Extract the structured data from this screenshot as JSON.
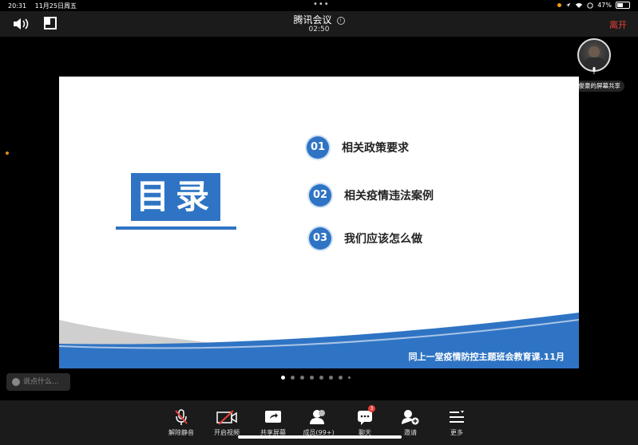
{
  "status_bar": {
    "time": "20:31",
    "date": "11月25日周五",
    "battery": "47%",
    "battery_level": 0.47
  },
  "meeting": {
    "title": "腾讯会议",
    "timer": "02:50",
    "leave_label": "离开"
  },
  "presenter": {
    "share_label": "翟俊豪的屏幕共享"
  },
  "slide": {
    "heading": "目录",
    "items": [
      {
        "num": "01",
        "text": "相关政策要求"
      },
      {
        "num": "02",
        "text": "相关疫情违法案例"
      },
      {
        "num": "03",
        "text": "我们应该怎么做"
      }
    ],
    "footer": "同上一堂疫情防控主题班会教育课.11月",
    "accent_color": "#2f74c4"
  },
  "chat": {
    "placeholder": "说点什么..."
  },
  "toolbar": {
    "unmute": "解除静音",
    "video": "开启视频",
    "share": "共享屏幕",
    "members": "成员(99+)",
    "chat": "聊天",
    "chat_badge": "3",
    "invite": "邀请",
    "more": "更多"
  }
}
